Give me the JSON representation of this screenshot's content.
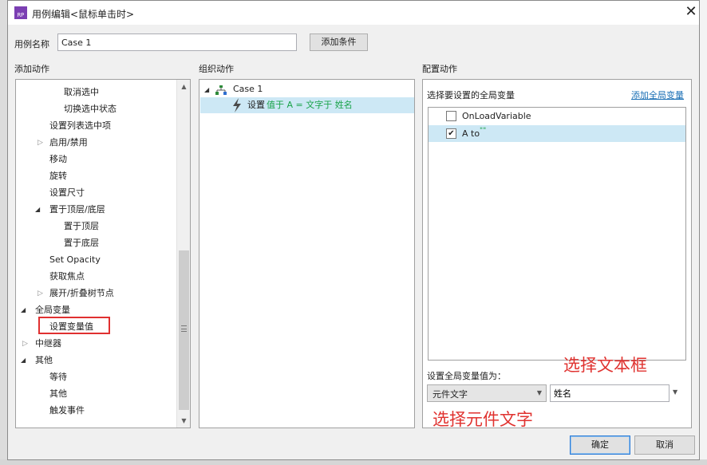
{
  "dialog": {
    "title": "用例编辑<鼠标单击时>",
    "app_icon": "RP",
    "close_glyph": "✕"
  },
  "case_name": {
    "label": "用例名称",
    "value": "Case 1",
    "add_condition_label": "添加条件"
  },
  "sections": {
    "add_action": "添加动作",
    "organize_action": "组织动作",
    "config_action": "配置动作"
  },
  "add_actions_tree": [
    {
      "label": "取消选中",
      "expander": ""
    },
    {
      "label": "切换选中状态",
      "expander": ""
    },
    {
      "label": "设置列表选中项",
      "expander": ""
    },
    {
      "label": "启用/禁用",
      "expander": "collapsed"
    },
    {
      "label": "移动",
      "expander": ""
    },
    {
      "label": "旋转",
      "expander": ""
    },
    {
      "label": "设置尺寸",
      "expander": ""
    },
    {
      "label": "置于顶层/底层",
      "expander": "expanded"
    },
    {
      "label": "置于顶层",
      "expander": ""
    },
    {
      "label": "置于底层",
      "expander": ""
    },
    {
      "label": "Set Opacity",
      "expander": ""
    },
    {
      "label": "获取焦点",
      "expander": ""
    },
    {
      "label": "展开/折叠树节点",
      "expander": "collapsed"
    },
    {
      "label": "全局变量",
      "expander": "expanded"
    },
    {
      "label": "设置变量值",
      "expander": ""
    },
    {
      "label": "中继器",
      "expander": "collapsed"
    },
    {
      "label": "其他",
      "expander": "expanded"
    },
    {
      "label": "等待",
      "expander": ""
    },
    {
      "label": "其他",
      "expander": ""
    },
    {
      "label": "触发事件",
      "expander": ""
    }
  ],
  "organize": {
    "case_label": "Case 1",
    "action_prefix": "设置",
    "action_detail": "值于 A = 文字于 姓名"
  },
  "config": {
    "select_var_label": "选择要设置的全局变量",
    "add_global_var_link": "添加全局变量",
    "variables": [
      {
        "label": "OnLoadVariable",
        "checked": false,
        "suffix": ""
      },
      {
        "label": "A to",
        "checked": true,
        "suffix": "\"\""
      }
    ],
    "set_value_label": "设置全局变量值为：",
    "value_type_selected": "元件文字",
    "target_widget_value": "姓名",
    "annotation_textbox": "选择文本框",
    "annotation_widget_text": "选择元件文字"
  },
  "footer": {
    "ok_label": "确定",
    "cancel_label": "取消"
  },
  "colors": {
    "highlight": "#cde8f5",
    "green": "#1aa34a",
    "link": "#1a6fb5",
    "annotation_red": "#e0322f",
    "app_icon_purple": "#7b3fb3"
  }
}
